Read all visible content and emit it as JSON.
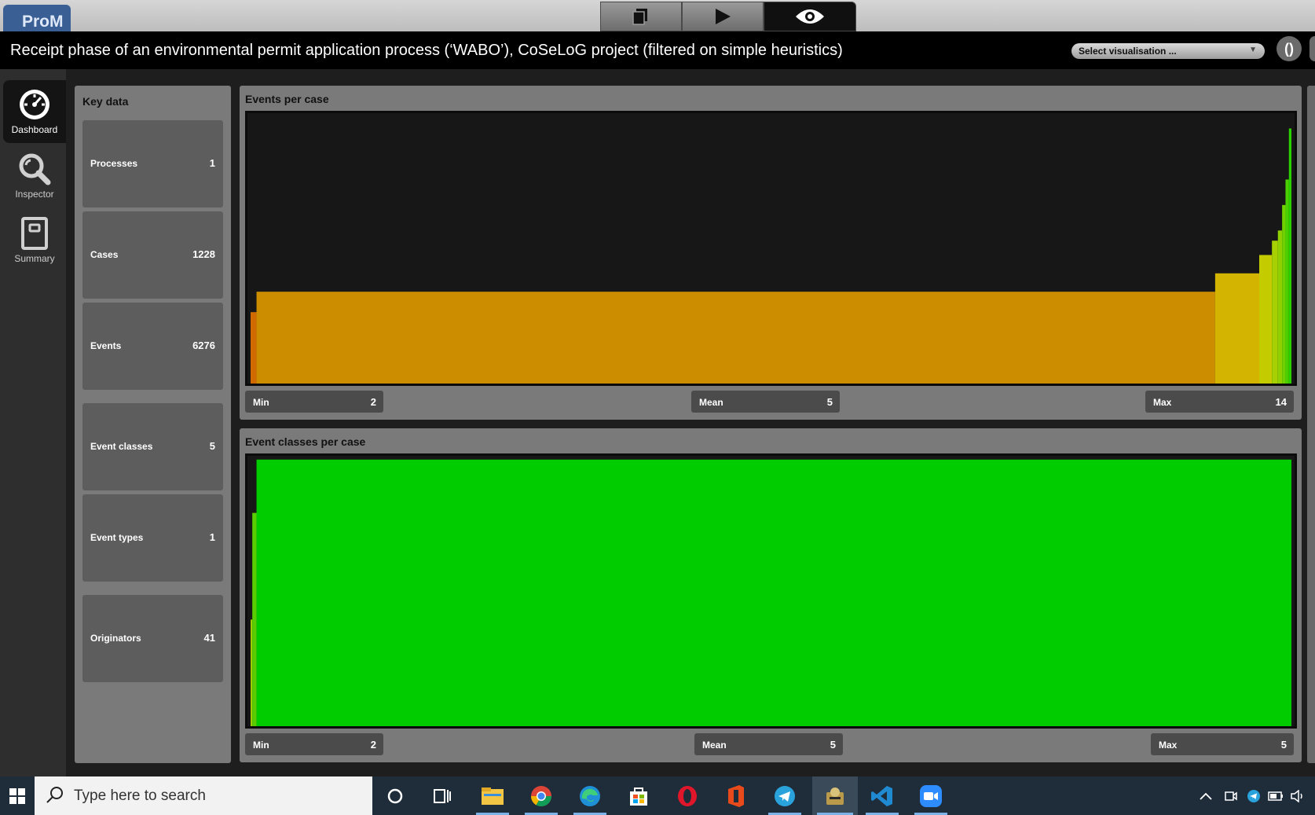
{
  "app": {
    "logo_text": "ProM"
  },
  "header": {
    "title": "Receipt phase of an environmental permit application process (‘WABO’), CoSeLoG project (filtered on simple heuristics)",
    "select_placeholder": "Select visualisation ...",
    "refresh_symbol": "()"
  },
  "nav": {
    "items": [
      {
        "label": "Dashboard",
        "icon": "gauge-icon",
        "active": true
      },
      {
        "label": "Inspector",
        "icon": "magnifier-icon",
        "active": false
      },
      {
        "label": "Summary",
        "icon": "book-icon",
        "active": false
      }
    ]
  },
  "key_data": {
    "title": "Key data",
    "items": [
      {
        "label": "Processes",
        "value": "1"
      },
      {
        "label": "Cases",
        "value": "1228"
      },
      {
        "label": "Events",
        "value": "6276"
      },
      {
        "label": "Event classes",
        "value": "5"
      },
      {
        "label": "Event types",
        "value": "1"
      },
      {
        "label": "Originators",
        "value": "41"
      }
    ]
  },
  "panels": {
    "events_per_case": {
      "title": "Events per case",
      "min_label": "Min",
      "min_value": "2",
      "mean_label": "Mean",
      "mean_value": "5",
      "max_label": "Max",
      "max_value": "14"
    },
    "event_classes_per_case": {
      "title": "Event classes per case",
      "min_label": "Min",
      "min_value": "2",
      "mean_label": "Mean",
      "mean_value": "5",
      "max_label": "Max",
      "max_value": "5"
    }
  },
  "chart_data": [
    {
      "type": "area",
      "title": "Events per case",
      "x_range": [
        0,
        1228
      ],
      "y_range": [
        0,
        14
      ],
      "segments": [
        {
          "from": 0,
          "to": 7,
          "value": 7,
          "color": "#d06a00"
        },
        {
          "from": 7,
          "to": 1138,
          "value": 9,
          "color": "#cc8e00"
        },
        {
          "from": 1138,
          "to": 1190,
          "value": 10.8,
          "color": "#d3b400"
        },
        {
          "from": 1190,
          "to": 1205,
          "value": 12.6,
          "color": "#c4cc00"
        },
        {
          "from": 1205,
          "to": 1212,
          "value": 14,
          "color": "#a6d000"
        },
        {
          "from": 1212,
          "to": 1217,
          "value": 15,
          "color": "#8fd000"
        },
        {
          "from": 1217,
          "to": 1221,
          "value": 17.5,
          "color": "#6fd000"
        },
        {
          "from": 1221,
          "to": 1225,
          "value": 20,
          "color": "#4ad000"
        },
        {
          "from": 1225,
          "to": 1228,
          "value": 25,
          "color": "#2ad000"
        }
      ]
    },
    {
      "type": "area",
      "title": "Event classes per case",
      "x_range": [
        0,
        1228
      ],
      "y_range": [
        0,
        5
      ],
      "segments": [
        {
          "from": 0,
          "to": 2,
          "value": 2,
          "color": "#9ccf00"
        },
        {
          "from": 2,
          "to": 7,
          "value": 4,
          "color": "#5acd00"
        },
        {
          "from": 7,
          "to": 1228,
          "value": 5,
          "color": "#00cc00"
        }
      ]
    }
  ],
  "taskbar": {
    "search_placeholder": "Type here to search",
    "icons": [
      "cortana-icon",
      "task-view-icon",
      "file-explorer-icon",
      "chrome-icon",
      "edge-icon",
      "store-icon",
      "opera-icon",
      "office-icon",
      "telegram-icon",
      "prom-icon",
      "vscode-icon",
      "zoom-icon"
    ],
    "tray": [
      "chevron-up-icon",
      "meet-icon",
      "telegram-tray-icon",
      "battery-icon",
      "volume-icon"
    ]
  }
}
